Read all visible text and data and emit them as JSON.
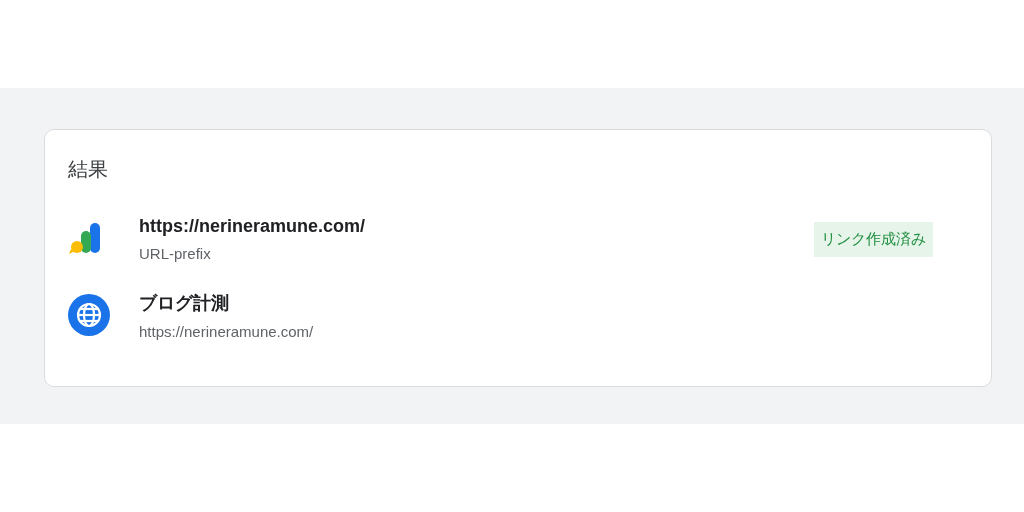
{
  "card": {
    "title": "結果",
    "items": [
      {
        "kind": "analytics",
        "title": "https://nerineramune.com/",
        "subtitle": "URL-prefix",
        "badge": "リンク作成済み"
      },
      {
        "kind": "globe",
        "title": "ブログ計測",
        "subtitle": "https://nerineramune.com/"
      }
    ]
  }
}
